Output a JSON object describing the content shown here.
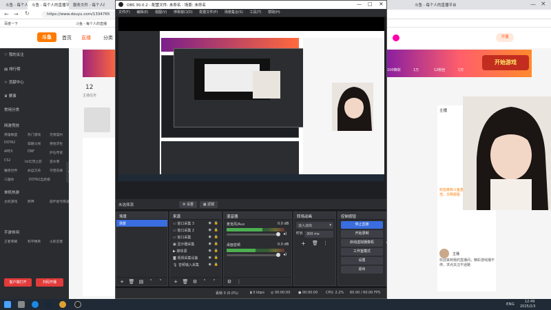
{
  "browser": {
    "tabs": [
      {
        "label": "斗鱼 - 每个人的直播平台"
      },
      {
        "label": "斗鱼 - 每个人的直播平台"
      },
      {
        "label": "服务文件 - 每个人的直播"
      },
      {
        "label": "斗鱼 - 每个人的直播平台"
      }
    ],
    "url": "https://www.douyu.com/1334765",
    "bookmarks": [
      "百度一下",
      "斗鱼 - 每个人的直播"
    ]
  },
  "douyu": {
    "logo": "斗鱼",
    "nav": [
      "首页",
      "直播",
      "分类"
    ],
    "sidebar": [
      "我的关注",
      "排行榜",
      "贡献中心",
      "赛事",
      "常用分类",
      "网游竞技",
      "单机热游",
      "手游休闲"
    ],
    "categories": [
      "英雄联盟",
      "热门游戏",
      "无畏契约",
      "DOTA2",
      "穿越火线",
      "绝地求生",
      "APEX",
      "DNF",
      "炉石传说",
      "CS2",
      "lol云顶之弈",
      "逆水寒",
      "魔兽世界",
      "命运方舟",
      "守望先锋",
      "三国杀",
      "DOTA2自走棋",
      "主机游戏",
      "原神",
      "崩坏星穹铁道",
      "王者荣耀",
      "和平精英",
      "火影忍者"
    ],
    "footer_buttons": [
      "客户端打开",
      "扫码开播"
    ],
    "room_count": "12",
    "room_label": "主播任务",
    "header_right": [
      "开播"
    ],
    "right_panel_title": "主播",
    "chat_lines": [
      "欢迎来到斗鱼直播间，请遵守直播规范，文明观看",
      "主播",
      "欢迎来到我的直播间，精彩游戏播不停，求点关注不迷路"
    ],
    "banner_game": "开始游戏",
    "gifts": [
      "100御剑",
      "1万",
      "12粉丝",
      "1万"
    ]
  },
  "obs": {
    "title": "OBS 30.0.2 - 配置文件: 未命名 - 场景: 未命名",
    "menu": [
      "文件(F)",
      "编辑(E)",
      "视图(V)",
      "停靠窗口(D)",
      "配置文件(P)",
      "场景集合(S)",
      "工具(T)",
      "帮助(H)"
    ],
    "no_source": "未选择源",
    "src_buttons": [
      "设置",
      "滤镜"
    ],
    "scenes": {
      "title": "场景",
      "items": [
        "场景"
      ]
    },
    "sources": {
      "title": "来源",
      "items": [
        "窗口采集 3",
        "窗口采集 2",
        "窗口采集",
        "显示器采集",
        "媒体源",
        "视频采集设备",
        "音频输入采集"
      ]
    },
    "mixer": {
      "title": "混音器",
      "channels": [
        {
          "name": "麦克风/Aux",
          "db": "0.0 dB",
          "level": 0.62
        },
        {
          "name": "桌面音频",
          "db": "0.0 dB",
          "level": 0.5
        }
      ]
    },
    "transitions": {
      "title": "转场动画",
      "type": "淡入淡出",
      "duration_label": "时长",
      "duration": "300 ms"
    },
    "controls": {
      "title": "控制按钮",
      "buttons": [
        "停止直播",
        "开始录制",
        "启动虚拟摄像机",
        "工作室模式",
        "设置",
        "退出"
      ]
    },
    "status": {
      "frames": "丢帧 0 (0.0%)",
      "kbps": "0 kbps",
      "rec": "00:00:00",
      "live": "00:00:00",
      "cpu": "CPU: 2.2%",
      "fps": "60.00 / 60.00 FPS"
    }
  },
  "taskbar": {
    "lang": "ENG",
    "time": "12:49",
    "date": "2025/2/3"
  },
  "colors": {
    "accent": "#3a6de0",
    "douyu_orange": "#ff7b00",
    "red": "#e23b3b"
  }
}
